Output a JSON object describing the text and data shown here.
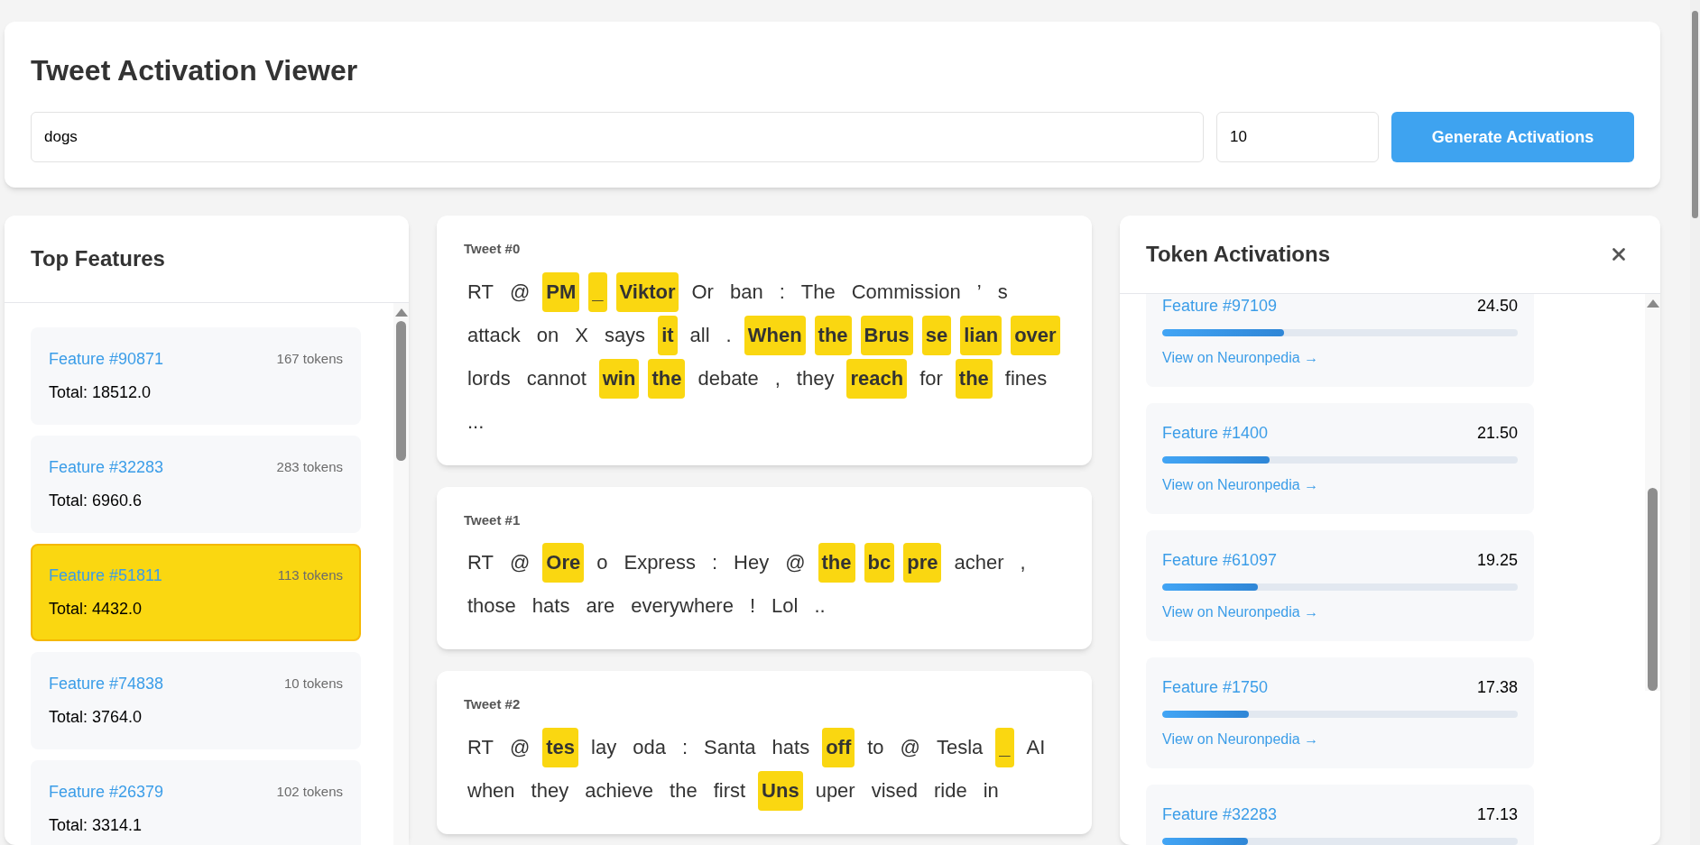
{
  "header": {
    "title": "Tweet Activation Viewer",
    "query": {
      "value": "dogs"
    },
    "count": {
      "value": "10"
    },
    "button": "Generate Activations"
  },
  "features_panel": {
    "title": "Top Features",
    "items": [
      {
        "name": "Feature #90871",
        "tokens": "167 tokens",
        "total": "Total: 18512.0",
        "selected": false
      },
      {
        "name": "Feature #32283",
        "tokens": "283 tokens",
        "total": "Total: 6960.6",
        "selected": false
      },
      {
        "name": "Feature #51811",
        "tokens": "113 tokens",
        "total": "Total: 4432.0",
        "selected": true
      },
      {
        "name": "Feature #74838",
        "tokens": "10 tokens",
        "total": "Total: 3764.0",
        "selected": false
      },
      {
        "name": "Feature #26379",
        "tokens": "102 tokens",
        "total": "Total: 3314.1",
        "selected": false
      }
    ]
  },
  "tweets": [
    {
      "label": "Tweet #0",
      "tokens": [
        {
          "text": "RT",
          "highlighted": false
        },
        {
          "text": "@",
          "highlighted": false
        },
        {
          "text": "PM",
          "highlighted": true
        },
        {
          "text": "_",
          "highlighted": true
        },
        {
          "text": "Viktor",
          "highlighted": true
        },
        {
          "text": "Or",
          "highlighted": false
        },
        {
          "text": "ban",
          "highlighted": false
        },
        {
          "text": ":",
          "highlighted": false
        },
        {
          "text": "The",
          "highlighted": false
        },
        {
          "text": "Commission",
          "highlighted": false
        },
        {
          "text": "’",
          "highlighted": false
        },
        {
          "text": "s",
          "highlighted": false
        },
        {
          "text": "attack",
          "highlighted": false
        },
        {
          "text": "on",
          "highlighted": false
        },
        {
          "text": "X",
          "highlighted": false
        },
        {
          "text": "says",
          "highlighted": false
        },
        {
          "text": "it",
          "highlighted": true
        },
        {
          "text": "all",
          "highlighted": false
        },
        {
          "text": ".",
          "highlighted": false
        },
        {
          "text": "When",
          "highlighted": true
        },
        {
          "text": "the",
          "highlighted": true
        },
        {
          "text": "Brus",
          "highlighted": true
        },
        {
          "text": "se",
          "highlighted": true
        },
        {
          "text": "lian",
          "highlighted": true
        },
        {
          "text": "over",
          "highlighted": true
        },
        {
          "text": "lords",
          "highlighted": false
        },
        {
          "text": "cannot",
          "highlighted": false
        },
        {
          "text": "win",
          "highlighted": true
        },
        {
          "text": "the",
          "highlighted": true
        },
        {
          "text": "debate",
          "highlighted": false
        },
        {
          "text": ",",
          "highlighted": false
        },
        {
          "text": "they",
          "highlighted": false
        },
        {
          "text": "reach",
          "highlighted": true
        },
        {
          "text": "for",
          "highlighted": false
        },
        {
          "text": "the",
          "highlighted": true
        },
        {
          "text": "fines",
          "highlighted": false
        },
        {
          "text": "...",
          "highlighted": false
        }
      ]
    },
    {
      "label": "Tweet #1",
      "tokens": [
        {
          "text": "RT",
          "highlighted": false
        },
        {
          "text": "@",
          "highlighted": false
        },
        {
          "text": "Ore",
          "highlighted": true
        },
        {
          "text": "o",
          "highlighted": false
        },
        {
          "text": "Express",
          "highlighted": false
        },
        {
          "text": ":",
          "highlighted": false
        },
        {
          "text": "Hey",
          "highlighted": false
        },
        {
          "text": "@",
          "highlighted": false
        },
        {
          "text": "the",
          "highlighted": true
        },
        {
          "text": "bc",
          "highlighted": true
        },
        {
          "text": "pre",
          "highlighted": true
        },
        {
          "text": "acher",
          "highlighted": false
        },
        {
          "text": ",",
          "highlighted": false
        },
        {
          "text": "those",
          "highlighted": false
        },
        {
          "text": "hats",
          "highlighted": false
        },
        {
          "text": "are",
          "highlighted": false
        },
        {
          "text": "everywhere",
          "highlighted": false
        },
        {
          "text": "!",
          "highlighted": false
        },
        {
          "text": "Lol",
          "highlighted": false
        },
        {
          "text": "..",
          "highlighted": false
        }
      ]
    },
    {
      "label": "Tweet #2",
      "tokens": [
        {
          "text": "RT",
          "highlighted": false
        },
        {
          "text": "@",
          "highlighted": false
        },
        {
          "text": "tes",
          "highlighted": true
        },
        {
          "text": "lay",
          "highlighted": false
        },
        {
          "text": "oda",
          "highlighted": false
        },
        {
          "text": ":",
          "highlighted": false
        },
        {
          "text": "Santa",
          "highlighted": false
        },
        {
          "text": "hats",
          "highlighted": false
        },
        {
          "text": "off",
          "highlighted": true
        },
        {
          "text": "to",
          "highlighted": false
        },
        {
          "text": "@",
          "highlighted": false
        },
        {
          "text": "Tesla",
          "highlighted": false
        },
        {
          "text": "_",
          "highlighted": true
        },
        {
          "text": "AI",
          "highlighted": false
        },
        {
          "text": "when",
          "highlighted": false
        },
        {
          "text": "they",
          "highlighted": false
        },
        {
          "text": "achieve",
          "highlighted": false
        },
        {
          "text": "the",
          "highlighted": false
        },
        {
          "text": "first",
          "highlighted": false
        },
        {
          "text": "Uns",
          "highlighted": true
        },
        {
          "text": "uper",
          "highlighted": false
        },
        {
          "text": "vised",
          "highlighted": false
        },
        {
          "text": "ride",
          "highlighted": false
        },
        {
          "text": "in",
          "highlighted": false
        }
      ]
    }
  ],
  "activations_panel": {
    "title": "Token Activations",
    "items": [
      {
        "name": "Feature #97109",
        "value": "24.50",
        "level": 0.342,
        "link": "View on Neuronpedia →"
      },
      {
        "name": "Feature #1400",
        "value": "21.50",
        "level": 0.301,
        "link": "View on Neuronpedia →"
      },
      {
        "name": "Feature #61097",
        "value": "19.25",
        "level": 0.27,
        "link": "View on Neuronpedia →"
      },
      {
        "name": "Feature #1750",
        "value": "17.38",
        "level": 0.243,
        "link": "View on Neuronpedia →"
      },
      {
        "name": "Feature #32283",
        "value": "17.13",
        "level": 0.24
      }
    ]
  }
}
